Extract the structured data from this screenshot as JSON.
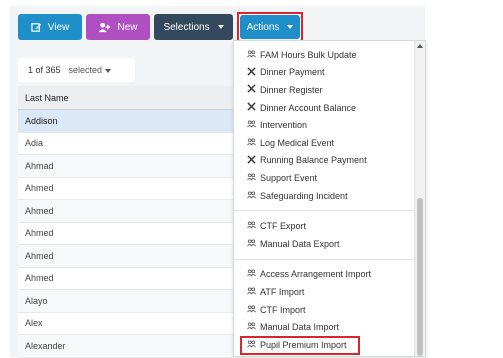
{
  "toolbar": {
    "view_label": "View",
    "new_label": "New",
    "selections_label": "Selections",
    "actions_label": "Actions"
  },
  "counter": {
    "count_text": "1 of 365",
    "selected_label": "selected"
  },
  "table": {
    "header": "Last Name",
    "rows": [
      "Addison",
      "Adia",
      "Ahmad",
      "Ahmed",
      "Ahmed",
      "Ahmed",
      "Ahmed",
      "Ahmed",
      "Alayo",
      "Alex",
      "Alexander"
    ]
  },
  "actions_menu": {
    "group1": [
      "FAM Hours Bulk Update",
      "Dinner Payment",
      "Dinner Register",
      "Dinner Account Balance",
      "Intervention",
      "Log Medical Event",
      "Running Balance Payment",
      "Support Event",
      "Safeguarding Incident"
    ],
    "group1_icons": [
      "people-icon",
      "fork-knife-icon",
      "fork-knife-icon",
      "fork-knife-icon",
      "people-icon",
      "people-icon",
      "fork-knife-icon",
      "people-icon",
      "people-icon"
    ],
    "group2": [
      "CTF Export",
      "Manual Data Export"
    ],
    "group3": [
      "Access Arrangement Import",
      "ATF Import",
      "CTF Import",
      "Manual Data Import",
      "Pupil Premium Import"
    ]
  },
  "colors": {
    "view_button": "#1e8fc9",
    "new_button": "#b04fbf",
    "selections_button": "#34495e",
    "actions_button": "#1e8fc9",
    "highlight_border": "#d9262c",
    "selected_row": "#dbe8f7"
  }
}
